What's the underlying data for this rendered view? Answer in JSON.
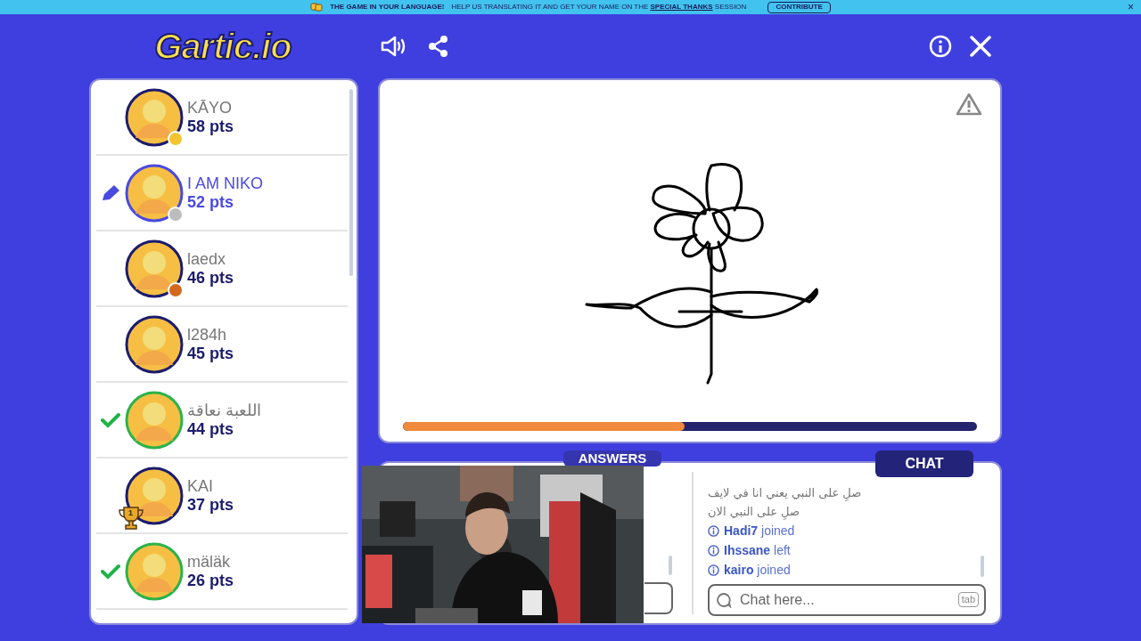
{
  "banner": {
    "headline": "THE GAME IN YOUR LANGUAGE!",
    "text": "HELP US TRANSLATING IT AND GET YOUR NAME ON THE **SPECIAL THANKS** SESSION",
    "button": "CONTRIBUTE",
    "close": "×"
  },
  "logo": "Gartic.io",
  "players": [
    {
      "name": "KĀYO",
      "points": "58 pts",
      "drawing": false,
      "guessed": false,
      "color": "#f4c430"
    },
    {
      "name": "I AM NIKO",
      "points": "52 pts",
      "drawing": true,
      "guessed": false,
      "color": "#bdbdbd"
    },
    {
      "name": "laedx",
      "points": "46 pts",
      "drawing": false,
      "guessed": false,
      "color": "#d2691e"
    },
    {
      "name": "l284h",
      "points": "45 pts",
      "drawing": false,
      "guessed": false
    },
    {
      "name": "اللعبة نعاقة",
      "points": "44 pts",
      "drawing": false,
      "guessed": true
    },
    {
      "name": "KAI",
      "points": "37 pts",
      "drawing": false,
      "guessed": false,
      "trophy": true,
      "trophy_label": "1"
    },
    {
      "name": "mäläk",
      "points": "26 pts",
      "drawing": false,
      "guessed": true
    }
  ],
  "timer": {
    "level": 0.49
  },
  "tabs": [
    {
      "label": "ANSWERS",
      "selected": false
    },
    {
      "label": "CHAT",
      "selected": true
    }
  ],
  "chat": [
    {
      "kind": "message",
      "text": "صلِ على النبي يعني انا في لايف"
    },
    {
      "kind": "message",
      "text": "صلِ على النبي الان"
    },
    {
      "kind": "event",
      "user": "Hadi7",
      "action": "joined"
    },
    {
      "kind": "event",
      "user": "Ihssane",
      "action": "left"
    },
    {
      "kind": "event",
      "user": "kairo",
      "action": "joined"
    }
  ],
  "chat_input": {
    "placeholder": "Chat here...",
    "key": "tab"
  }
}
